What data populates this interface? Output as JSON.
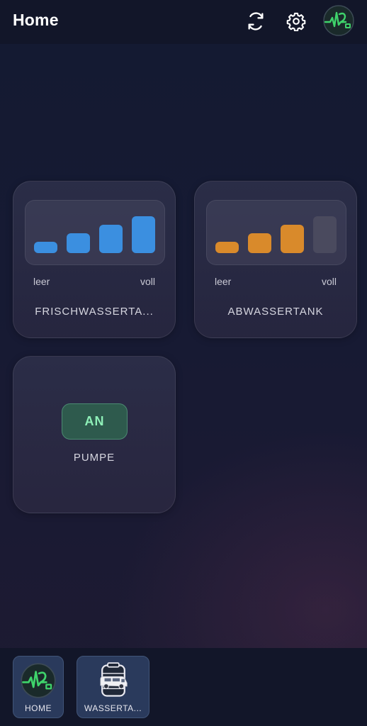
{
  "header": {
    "title": "Home",
    "refresh_icon": "refresh-icon",
    "settings_icon": "gear-icon",
    "logo_icon": "heartbeat-logo-icon"
  },
  "cards": {
    "fresh_tank": {
      "name": "FRISCHWASSERTA...",
      "min_label": "leer",
      "max_label": "voll",
      "level_bars_filled": 4,
      "level_bars_total": 4,
      "color": "#3b8fe0"
    },
    "waste_tank": {
      "name": "ABWASSERTANK",
      "min_label": "leer",
      "max_label": "voll",
      "level_bars_filled": 3,
      "level_bars_total": 4,
      "color": "#d98a2b",
      "empty_color": "#4a4a5e"
    },
    "pump": {
      "name": "PUMPE",
      "state": "AN",
      "state_color": "#8ff0b8"
    }
  },
  "bottom_nav": {
    "items": [
      {
        "label": "HOME",
        "icon": "heartbeat-logo-icon"
      },
      {
        "label": "WASSERTA...",
        "icon": "water-tank-camper-icon"
      }
    ]
  }
}
